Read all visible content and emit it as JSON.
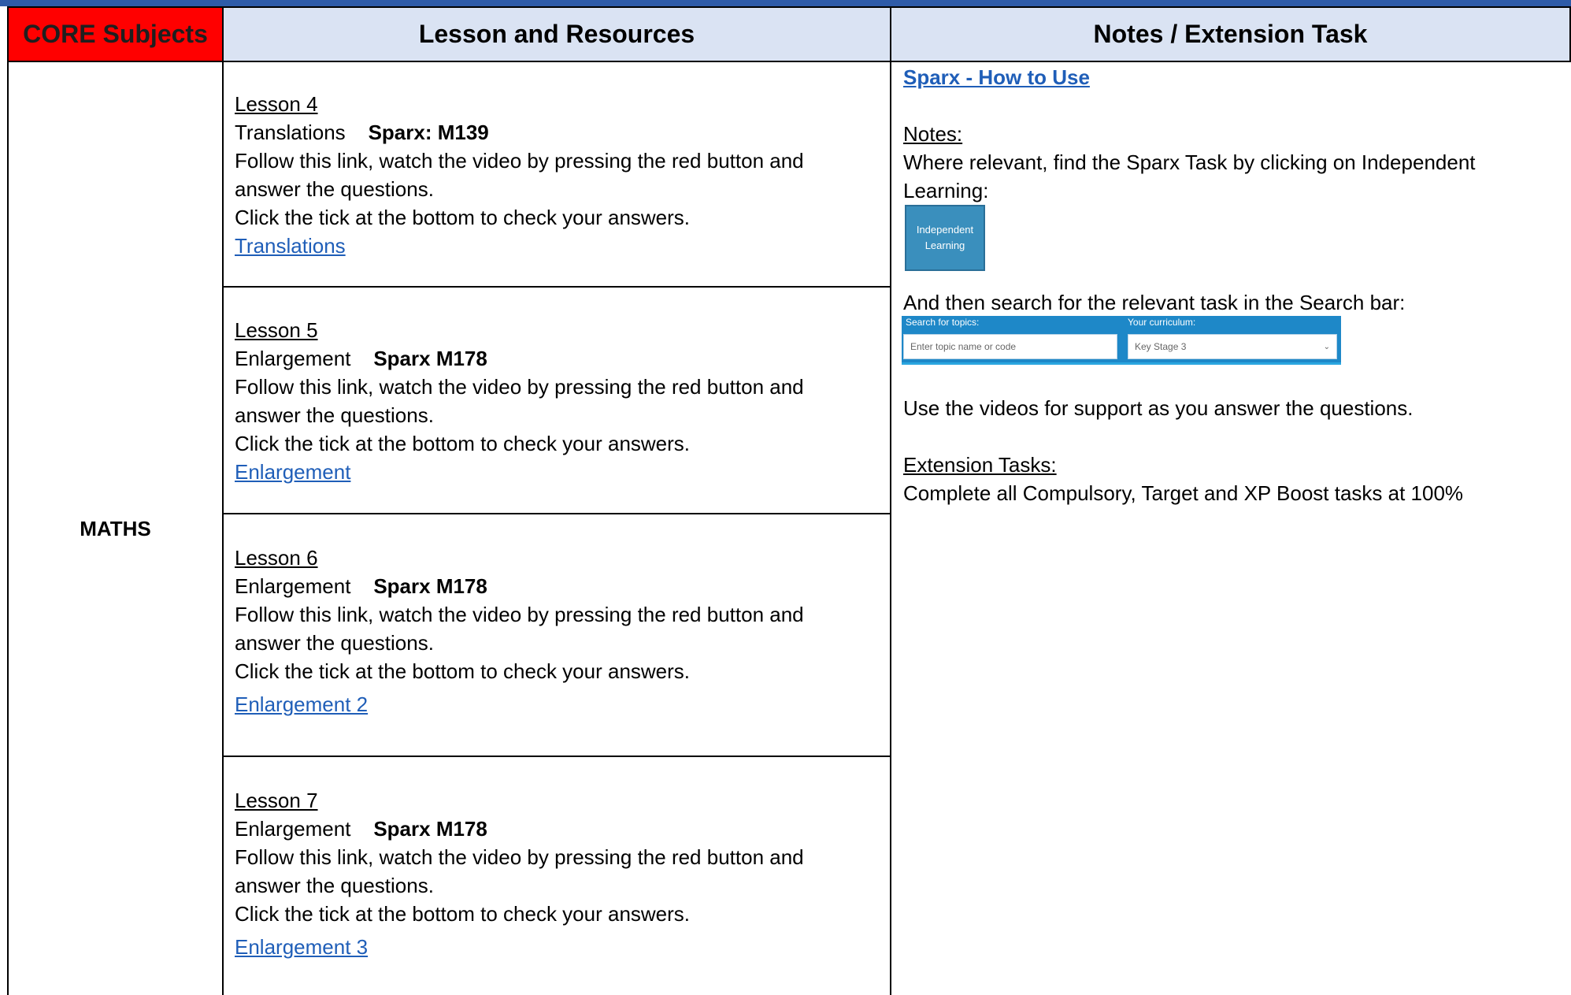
{
  "header": {
    "core_subjects": "CORE Subjects",
    "lesson_resources": "Lesson and Resources",
    "notes_extension": "Notes / Extension Task"
  },
  "subject": "MATHS",
  "lessons": [
    {
      "title": "Lesson 4",
      "topic": "Translations",
      "code": "Sparx: M139",
      "instruction_1": "Follow this link, watch the video by pressing the red button and",
      "instruction_2": "answer the questions.",
      "instruction_3": "Click the tick at the bottom to check your answers.",
      "link": "Translations"
    },
    {
      "title": "Lesson 5",
      "topic": "Enlargement",
      "code": "Sparx M178",
      "instruction_1": "Follow this link, watch the video by pressing the red button and",
      "instruction_2": "answer the questions.",
      "instruction_3": "Click the tick at the bottom to check your answers.",
      "link": "Enlargement"
    },
    {
      "title": "Lesson 6",
      "topic": "Enlargement",
      "code": "Sparx M178",
      "instruction_1": "Follow this link, watch the video by pressing the red button and",
      "instruction_2": "answer the questions.",
      "instruction_3": "Click the tick at the bottom to check your answers.",
      "link": "Enlargement 2"
    },
    {
      "title": "Lesson 7",
      "topic": "Enlargement",
      "code": "Sparx M178",
      "instruction_1": "Follow this link, watch the video by pressing the red button and",
      "instruction_2": "answer the questions.",
      "instruction_3": "Click the tick at the bottom to check your answers.",
      "link": "Enlargement 3"
    }
  ],
  "notes": {
    "howto_link": "Sparx - How to Use",
    "notes_heading": "Notes:",
    "notes_line_1": "Where relevant, find the Sparx Task by clicking on Independent",
    "notes_line_2": "Learning:",
    "independent_button": [
      "Independent",
      "Learning"
    ],
    "search_line": "And then search for the relevant task in the Search bar:",
    "search_topics_label": "Search for topics:",
    "search_placeholder": "Enter topic name or code",
    "curriculum_label": "Your curriculum:",
    "curriculum_value": "Key Stage 3",
    "videos_line": "Use the videos for support as you answer the questions.",
    "extension_heading": "Extension Tasks:",
    "extension_line": "Complete all Compulsory, Target and XP Boost tasks at 100%"
  },
  "colors": {
    "core_header_bg": "#ff0000",
    "header_bg": "#dae3f3",
    "link": "#1f5eb8",
    "topbar": "#2e5ba8"
  }
}
